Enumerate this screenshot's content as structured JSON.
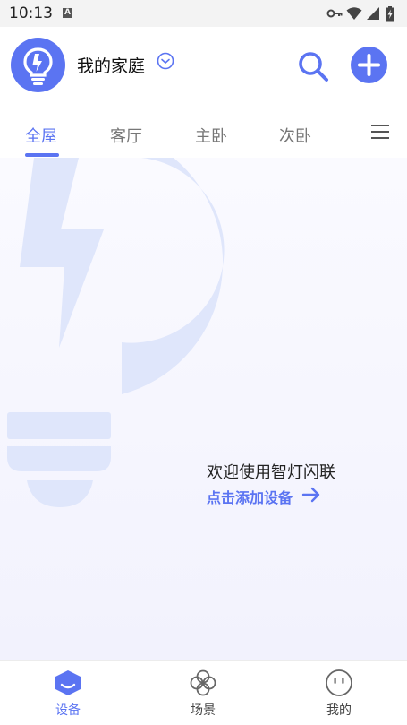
{
  "status_bar": {
    "time": "10:13",
    "indicator_letter": "A"
  },
  "header": {
    "home_name": "我的家庭",
    "avatar_icon": "lightning-bulb-icon",
    "dropdown_icon": "chevron-down-circle-icon",
    "search_icon": "search-icon",
    "add_icon": "plus-icon"
  },
  "tabs": [
    {
      "label": "全屋",
      "active": true
    },
    {
      "label": "客厅",
      "active": false
    },
    {
      "label": "主卧",
      "active": false
    },
    {
      "label": "次卧",
      "active": false
    }
  ],
  "tabs_menu_icon": "hamburger-menu-icon",
  "main": {
    "welcome": "欢迎使用智灯闪联",
    "add_device": "点击添加设备",
    "arrow_icon": "arrow-right-icon"
  },
  "bottom_nav": [
    {
      "label": "设备",
      "icon": "device-icon",
      "active": true
    },
    {
      "label": "场景",
      "icon": "scene-icon",
      "active": false
    },
    {
      "label": "我的",
      "icon": "profile-icon",
      "active": false
    }
  ],
  "colors": {
    "accent": "#5b74f2",
    "watermark": "#dfe6fb"
  }
}
